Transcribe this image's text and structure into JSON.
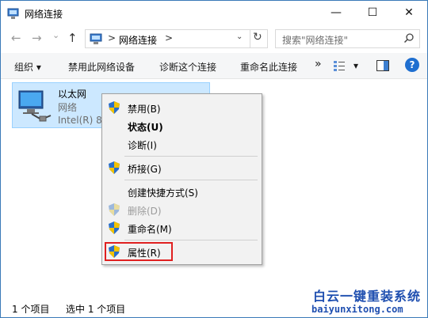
{
  "window": {
    "title": "网络连接",
    "minimize_glyph": "—",
    "maximize_glyph": "☐",
    "close_glyph": "✕"
  },
  "nav": {
    "back": "←",
    "forward": "→",
    "recent": "⌄",
    "up": "↑"
  },
  "address": {
    "chevron": ">",
    "path": "网络连接",
    "trailing_chevron": ">",
    "dropdown": "⌄",
    "refresh": "↻"
  },
  "search": {
    "placeholder": "搜索\"网络连接\""
  },
  "commands": {
    "organize": "组织 ▾",
    "disable": "禁用此网络设备",
    "diagnose": "诊断这个连接",
    "rename": "重命名此连接",
    "more": "»",
    "view_dropdown": "▾",
    "help": "?"
  },
  "item": {
    "name": "以太网",
    "status": "网络",
    "adapter": "Intel(R) 82"
  },
  "context_menu": {
    "items": [
      {
        "label": "禁用(B)",
        "shield": true
      },
      {
        "label": "状态(U)",
        "bold": true
      },
      {
        "label": "诊断(I)"
      },
      {
        "label": "桥接(G)",
        "shield": true
      },
      {
        "label": "创建快捷方式(S)"
      },
      {
        "label": "删除(D)",
        "shield": true,
        "disabled": true
      },
      {
        "label": "重命名(M)",
        "shield": true
      },
      {
        "label": "属性(R)",
        "shield": true
      }
    ]
  },
  "statusbar": {
    "count": "1 个项目",
    "selected": "选中 1 个项目"
  },
  "watermark": {
    "line1": "白云一键重装系统",
    "line2": "baiyunxitong.com"
  },
  "colors": {
    "selection": "#cce8ff",
    "highlight_box": "#e02020",
    "shield_blue": "#2a6fc9",
    "shield_yellow": "#f2c200"
  }
}
